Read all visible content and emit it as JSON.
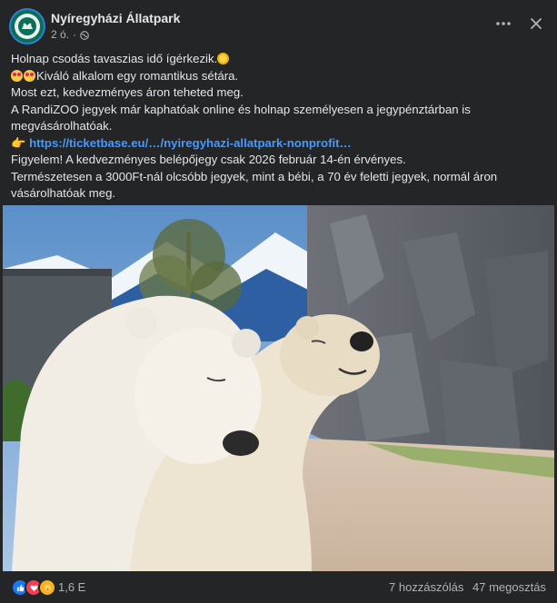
{
  "header": {
    "page_name": "Nyíregyházi Állatpark",
    "time_ago": "2 ó.",
    "separator": "·",
    "audience_icon": "globe-icon"
  },
  "post": {
    "lines": [
      "Holnap csodás tavaszias idő ígérkezik.",
      "Kiváló alkalom egy romantikus sétára.",
      "Most ezt, kedvezményes áron teheted meg.",
      "A RandiZOO jegyek már kaphatóak online és holnap személyesen a jegypénztárban is megvásárolhatóak.",
      "https://ticketbase.eu/…/nyiregyhazi-allatpark-nonprofit…",
      "Figyelem! A kedvezményes belépőjegy csak 2026 február 14-én érvényes.",
      "Természetesen a 3000Ft-nál olcsóbb jegyek, mint a bébi, a 70 év feletti jegyek, normál áron vásárolhatóak meg."
    ],
    "emoji": {
      "sun": "sun-emoji",
      "heart_eyes": "heart-eyes-emoji",
      "pointer": "👉"
    },
    "photo_alt": "Two polar bears embracing in a zoo enclosure"
  },
  "footer": {
    "reaction_icons": [
      "like-icon",
      "love-icon",
      "care-icon"
    ],
    "reaction_count": "1,6 E",
    "comments": "7 hozzászólás",
    "shares": "47 megosztás"
  },
  "colors": {
    "background": "#242526",
    "text": "#e4e6eb",
    "secondary": "#b0b3b8",
    "link": "#4599ff",
    "like": "#1877f2",
    "love": "#f33e58"
  }
}
